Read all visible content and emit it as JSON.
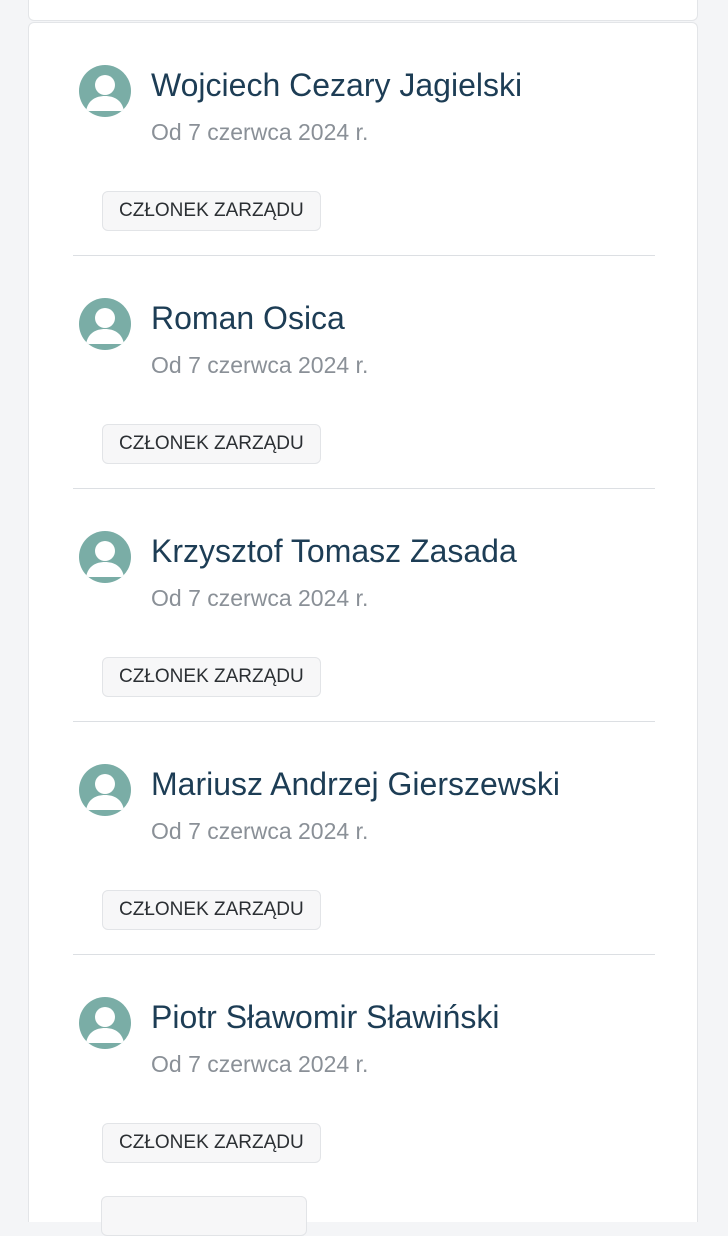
{
  "members": [
    {
      "name": "Wojciech Cezary Jagielski",
      "since": "Od 7 czerwca 2024 r.",
      "role": "CZŁONEK ZARZĄDU"
    },
    {
      "name": "Roman Osica",
      "since": "Od 7 czerwca 2024 r.",
      "role": "CZŁONEK ZARZĄDU"
    },
    {
      "name": "Krzysztof Tomasz Zasada",
      "since": "Od 7 czerwca 2024 r.",
      "role": "CZŁONEK ZARZĄDU"
    },
    {
      "name": "Mariusz Andrzej Gierszewski",
      "since": "Od 7 czerwca 2024 r.",
      "role": "CZŁONEK ZARZĄDU"
    },
    {
      "name": "Piotr Sławomir Sławiński",
      "since": "Od 7 czerwca 2024 r.",
      "role": "CZŁONEK ZARZĄDU"
    }
  ],
  "icons": {
    "avatar": "user-avatar-icon"
  },
  "colors": {
    "name_text": "#1d3d55",
    "since_text": "#8a9097",
    "avatar_bg": "#7aada6"
  }
}
